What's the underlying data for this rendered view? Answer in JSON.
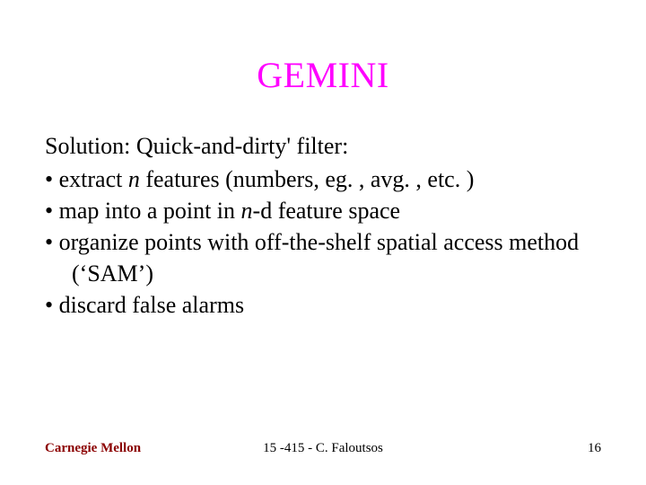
{
  "title": "GEMINI",
  "lead": "Solution: Quick-and-dirty' filter:",
  "bullets": [
    {
      "pre": "extract ",
      "em": "n",
      "post": " features (numbers, eg. , avg. , etc. )"
    },
    {
      "pre": "map into a point in ",
      "em": "n",
      "post": "-d feature space"
    },
    {
      "pre": "organize points with off-the-shelf spatial access method (‘SAM’)",
      "em": "",
      "post": ""
    },
    {
      "pre": "discard false alarms",
      "em": "",
      "post": ""
    }
  ],
  "footer": {
    "left": "Carnegie Mellon",
    "center": "15 -415 - C. Faloutsos",
    "right": "16"
  }
}
